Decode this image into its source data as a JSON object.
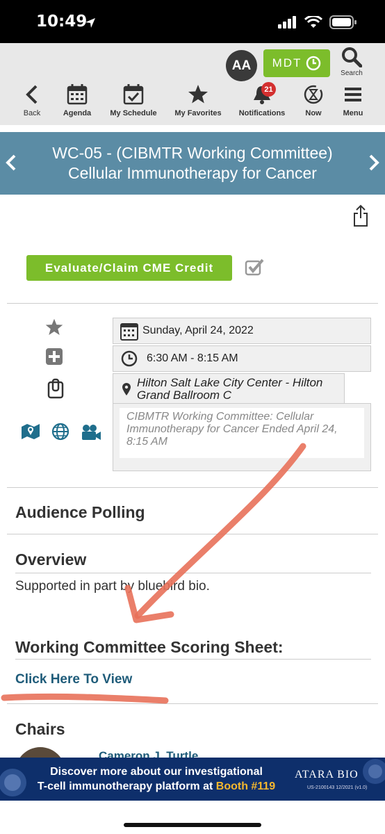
{
  "status_bar": {
    "time": "10:49"
  },
  "header": {
    "avatar_initials": "AA",
    "mdt_label": "MDT",
    "search_label": "Search",
    "nav": [
      {
        "label": "Back"
      },
      {
        "label": "Agenda"
      },
      {
        "label": "My Schedule"
      },
      {
        "label": "My Favorites"
      },
      {
        "label": "Notifications",
        "badge": "21"
      },
      {
        "label": "Now"
      },
      {
        "label": "Menu"
      }
    ]
  },
  "session": {
    "title": "WC-05 - (CIBMTR Working Committee) Cellular Immunotherapy for Cancer",
    "cme_button": "Evaluate/Claim CME Credit",
    "date": "Sunday, April 24, 2022",
    "time": "6:30 AM - 8:15 AM",
    "location": "Hilton Salt Lake City Center - Hilton Grand Ballroom C",
    "status": "CIBMTR Working Committee: Cellular Immunotherapy for Cancer Ended April 24, 8:15 AM"
  },
  "sections": {
    "audience_polling": "Audience Polling",
    "overview": "Overview",
    "overview_text": "Supported in part by bluebird bio.",
    "scoring_sheet": "Working Committee Scoring Sheet:",
    "scoring_link": "Click Here To View",
    "chairs": "Chairs",
    "chair_name": "Cameron J. Turtle"
  },
  "ad": {
    "line1": "Discover more about our investigational",
    "line2_prefix": "T-cell immunotherapy platform at ",
    "line2_booth": "Booth #119",
    "logo": "ATARA BIO",
    "code": "US-2100143 12/2021 (v1.0)"
  },
  "colors": {
    "accent_green": "#7cbd2b",
    "title_bar": "#5b8ca5",
    "link": "#1f5c7a",
    "badge": "#d32f2f",
    "annotation": "#e8715a",
    "ad_bg": "#0e2f6b",
    "booth": "#f5b82e"
  }
}
